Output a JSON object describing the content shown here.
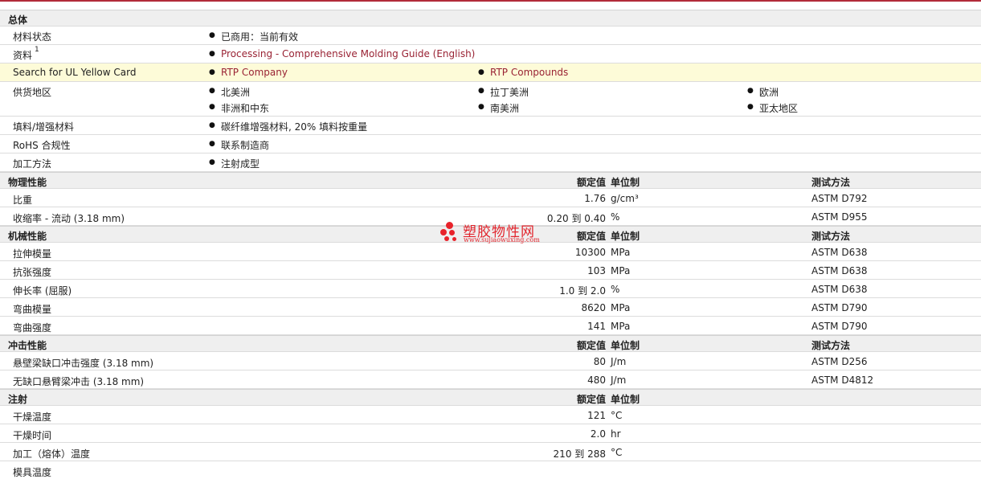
{
  "general": {
    "title": "总体",
    "status_label": "材料状态",
    "status_value": "已商用：当前有效",
    "docs_label": "资料",
    "docs_sup": "1",
    "docs_link": "Processing - Comprehensive Molding Guide (English)",
    "ul_label": "Search for UL Yellow Card",
    "ul_link1": "RTP Company",
    "ul_link2": "RTP Compounds",
    "regions_label": "供货地区",
    "regions": [
      "北美洲",
      "拉丁美洲",
      "欧洲",
      "非洲和中东",
      "南美洲",
      "亚太地区"
    ],
    "filler_label": "填料/增强材料",
    "filler_value": "碳纤维增强材料, 20% 填料按重量",
    "rohs_label": "RoHS 合规性",
    "rohs_value": "联系制造商",
    "process_label": "加工方法",
    "process_value": "注射成型"
  },
  "headers": {
    "nominal": "额定值",
    "unit": "单位制",
    "method": "测试方法"
  },
  "physical": {
    "title": "物理性能",
    "rows": [
      {
        "label": "比重",
        "value": "1.76",
        "unit": "g/cm³",
        "method": "ASTM D792"
      },
      {
        "label": "收缩率  - 流动  (3.18 mm)",
        "value": "0.20 到  0.40",
        "unit": "%",
        "method": "ASTM D955"
      }
    ]
  },
  "mechanical": {
    "title": "机械性能",
    "rows": [
      {
        "label": "拉伸模量",
        "value": "10300",
        "unit": "MPa",
        "method": "ASTM D638"
      },
      {
        "label": "抗张强度",
        "value": "103",
        "unit": "MPa",
        "method": "ASTM D638"
      },
      {
        "label": "伸长率  (屈服)",
        "value": "1.0 到  2.0",
        "unit": "%",
        "method": "ASTM D638"
      },
      {
        "label": "弯曲模量",
        "value": "8620",
        "unit": "MPa",
        "method": "ASTM D790"
      },
      {
        "label": "弯曲强度",
        "value": "141",
        "unit": "MPa",
        "method": "ASTM D790"
      }
    ]
  },
  "impact": {
    "title": "冲击性能",
    "rows": [
      {
        "label": "悬壁梁缺口冲击强度  (3.18 mm)",
        "value": "80",
        "unit": "J/m",
        "method": "ASTM D256"
      },
      {
        "label": "无缺口悬臂梁冲击  (3.18 mm)",
        "value": "480",
        "unit": "J/m",
        "method": "ASTM D4812"
      }
    ]
  },
  "injection": {
    "title": "注射",
    "rows": [
      {
        "label": "干燥温度",
        "value": "121",
        "unit": "°C"
      },
      {
        "label": "干燥时间",
        "value": "2.0",
        "unit": "hr"
      },
      {
        "label": "加工（熔体）温度",
        "value": "210 到  288",
        "unit": "°C"
      },
      {
        "label": "模具温度",
        "value": "",
        "unit": ""
      }
    ]
  },
  "watermark": {
    "name": "塑胶物性网",
    "url": "www.sujiaowuxing.com",
    "color": "#e2252d"
  }
}
